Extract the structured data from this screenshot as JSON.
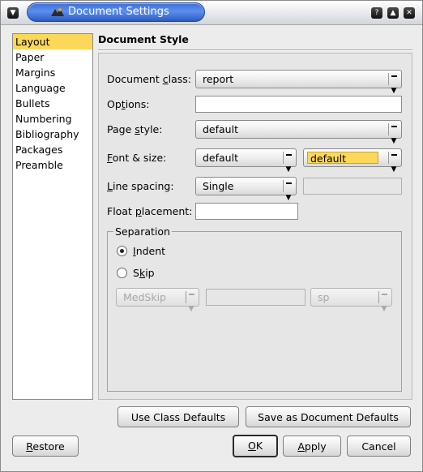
{
  "window": {
    "title": "Document Settings"
  },
  "sidebar": {
    "items": [
      {
        "label": "Layout"
      },
      {
        "label": "Paper"
      },
      {
        "label": "Margins"
      },
      {
        "label": "Language"
      },
      {
        "label": "Bullets"
      },
      {
        "label": "Numbering"
      },
      {
        "label": "Bibliography"
      },
      {
        "label": "Packages"
      },
      {
        "label": "Preamble"
      }
    ],
    "selected": "Layout"
  },
  "panel": {
    "title": "Document Style",
    "doc_class": {
      "label_pre": "Document ",
      "label_ul": "c",
      "label_post": "lass:",
      "value": "report"
    },
    "options": {
      "label_pre": "Op",
      "label_ul": "t",
      "label_post": "ions:",
      "value": ""
    },
    "page_style": {
      "label_pre": "Page ",
      "label_ul": "s",
      "label_post": "tyle:",
      "value": "default"
    },
    "font_size": {
      "label_pre": "",
      "label_ul": "F",
      "label_post": "ont & size:",
      "font_value": "default",
      "size_value": "default"
    },
    "line_spacing": {
      "label_pre": "",
      "label_ul": "L",
      "label_post": "ine spacing:",
      "value": "Single",
      "extra_value": ""
    },
    "float_placement": {
      "label_pre": "Float ",
      "label_ul": "p",
      "label_post": "lacement:",
      "value": ""
    },
    "separation": {
      "legend": "Separation",
      "indent": {
        "label_pre": "",
        "label_ul": "I",
        "label_post": "ndent",
        "checked": true
      },
      "skip": {
        "label_pre": "S",
        "label_ul": "k",
        "label_post": "ip",
        "checked": false
      },
      "skip_amount": "MedSkip",
      "skip_length": "",
      "skip_unit": "sp"
    }
  },
  "buttons": {
    "use_class_defaults": "Use Class Defaults",
    "save_as_defaults": "Save as Document Defaults",
    "restore_ul": "R",
    "restore_post": "estore",
    "ok_ul": "O",
    "ok_post": "K",
    "apply_pre": "",
    "apply_ul": "A",
    "apply_post": "pply",
    "cancel": "Cancel"
  },
  "colors": {
    "selection": "#fbd75a",
    "title_bar": "#3d6fd6"
  }
}
